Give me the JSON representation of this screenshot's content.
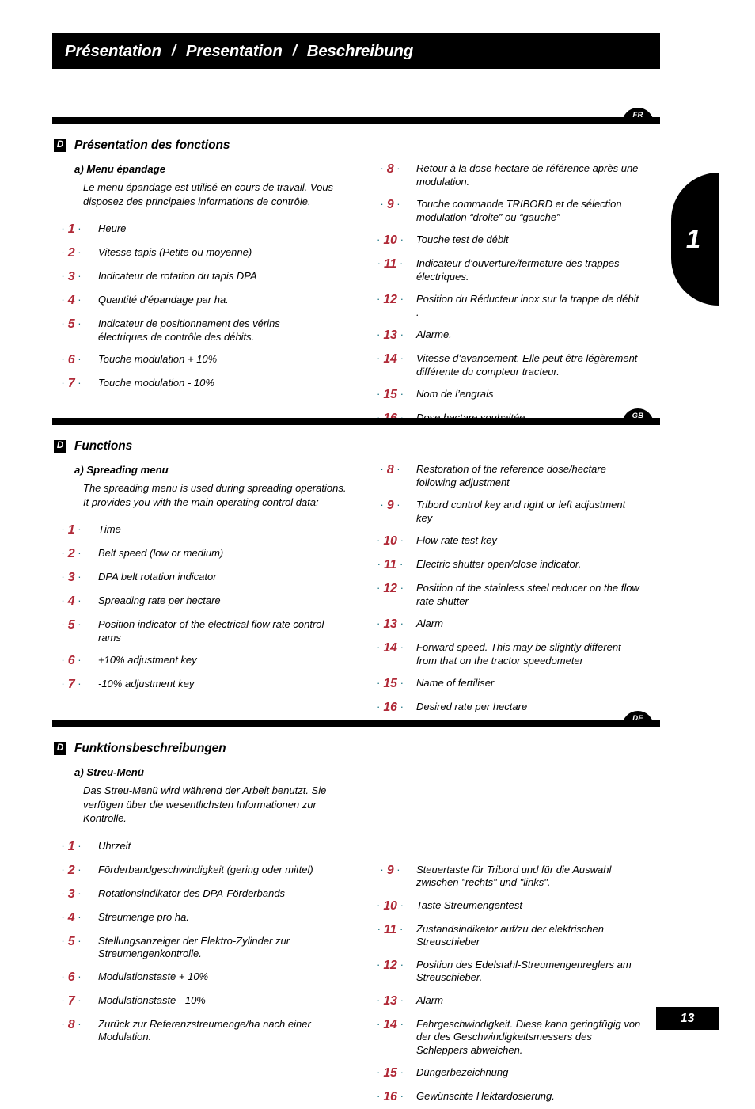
{
  "header": {
    "title_fr": "Présentation",
    "title_en": "Presentation",
    "title_de": "Beschreibung",
    "separator": "/"
  },
  "chapter_tab": {
    "label": "1"
  },
  "footer": {
    "page_number": "13"
  },
  "colors": {
    "number_red": "#b02a38",
    "bullet_teal": "#15707f",
    "bar_black": "#000000"
  },
  "sections": [
    {
      "lang_badge": "FR",
      "badge_letter": "D",
      "section_title": "Présentation des fonctions",
      "subsection_title": "a) Menu épandage",
      "intro": "Le menu épandage est utilisé en cours de travail. Vous disposez des principales informations de contrôle.",
      "left_items": [
        {
          "num": "1",
          "text": "Heure"
        },
        {
          "num": "2",
          "text": "Vitesse tapis (Petite ou moyenne)"
        },
        {
          "num": "3",
          "text": "Indicateur de rotation du tapis DPA"
        },
        {
          "num": "4",
          "text": "Quantité d’épandage par ha."
        },
        {
          "num": "5",
          "text": "Indicateur de positionnement des vérins électriques de contrôle des débits."
        },
        {
          "num": "6",
          "text": "Touche modulation + 10%"
        },
        {
          "num": "7",
          "text": "Touche modulation - 10%"
        }
      ],
      "right_items": [
        {
          "num": "8",
          "text": "Retour à la dose hectare de référence après une modulation."
        },
        {
          "num": "9",
          "text": "Touche commande TRIBORD et de sélection modulation    “droite” ou “gauche”"
        },
        {
          "num": "10",
          "text": "Touche test de débit"
        },
        {
          "num": "11",
          "text": "Indicateur d’ouverture/fermeture des trappes électriques."
        },
        {
          "num": "12",
          "text": "Position du Réducteur inox sur la trappe de débit ."
        },
        {
          "num": "13",
          "text": "Alarme."
        },
        {
          "num": "14",
          "text": "Vitesse d’avancement. Elle peut être légèrement différente du compteur tracteur."
        },
        {
          "num": "15",
          "text": "Nom de l’engrais"
        },
        {
          "num": "16",
          "text": "Dose hectare souhaitée."
        }
      ]
    },
    {
      "lang_badge": "GB",
      "badge_letter": "D",
      "section_title": "Functions",
      "subsection_title": "a) Spreading menu",
      "intro": "The spreading menu is used during spreading operations. It provides you with the main operating control data:",
      "left_items": [
        {
          "num": "1",
          "text": "Time"
        },
        {
          "num": "2",
          "text": "Belt speed (low or medium)"
        },
        {
          "num": "3",
          "text": "DPA belt rotation indicator"
        },
        {
          "num": "4",
          "text": "Spreading rate per hectare"
        },
        {
          "num": "5",
          "text": "Position indicator of the electrical flow rate control rams"
        },
        {
          "num": "6",
          "text": "+10% adjustment key"
        },
        {
          "num": "7",
          "text": "-10% adjustment key"
        }
      ],
      "right_items": [
        {
          "num": "8",
          "text": "Restoration of the reference dose/hectare following adjustment"
        },
        {
          "num": "9",
          "text": "Tribord control key and right or left adjustment key"
        },
        {
          "num": "10",
          "text": "Flow rate test key"
        },
        {
          "num": "11",
          "text": "Electric shutter open/close indicator."
        },
        {
          "num": "12",
          "text": "Position of the stainless steel reducer on the flow rate shutter"
        },
        {
          "num": "13",
          "text": "Alarm"
        },
        {
          "num": "14",
          "text": "Forward speed. This may be slightly different from that on the tractor speedometer"
        },
        {
          "num": "15",
          "text": "Name of fertiliser"
        },
        {
          "num": "16",
          "text": "Desired rate per hectare"
        }
      ]
    },
    {
      "lang_badge": "DE",
      "badge_letter": "D",
      "section_title": "Funktionsbeschreibungen",
      "subsection_title": "a) Streu-Menü",
      "intro": "Das Streu-Menü wird während der Arbeit benutzt. Sie verfügen über die wesentlichsten Informationen zur Kontrolle.",
      "left_items": [
        {
          "num": "1",
          "text": "Uhrzeit"
        },
        {
          "num": "2",
          "text": "Förderbandgeschwindigkeit (gering oder mittel)"
        },
        {
          "num": "3",
          "text": "Rotationsindikator des DPA-Förderbands"
        },
        {
          "num": "4",
          "text": "Streumenge pro ha."
        },
        {
          "num": "5",
          "text": "Stellungsanzeiger der Elektro-Zylinder zur Streumengenkontrolle."
        },
        {
          "num": "6",
          "text": "Modulationstaste + 10%"
        },
        {
          "num": "7",
          "text": "Modulationstaste - 10%"
        },
        {
          "num": "8",
          "text": "Zurück zur Referenzstreumenge/ha nach einer Modulation."
        }
      ],
      "right_items": [
        {
          "num": "9",
          "text": "Steuertaste für Tribord und für die Auswahl zwischen \"rechts\" und \"links\"."
        },
        {
          "num": "10",
          "text": "Taste Streumengentest"
        },
        {
          "num": "11",
          "text": "Zustandsindikator auf/zu der elektrischen Streuschieber"
        },
        {
          "num": "12",
          "text": "Position des Edelstahl-Streumengenreglers am Streuschieber."
        },
        {
          "num": "13",
          "text": " Alarm"
        },
        {
          "num": "14",
          "text": "Fahrgeschwindigkeit. Diese kann geringfügig von der des Geschwindigkeitsmessers des Schleppers abweichen."
        },
        {
          "num": "15",
          "text": "Düngerbezeichnung"
        },
        {
          "num": "16",
          "text": "Gewünschte Hektardosierung."
        }
      ]
    }
  ]
}
